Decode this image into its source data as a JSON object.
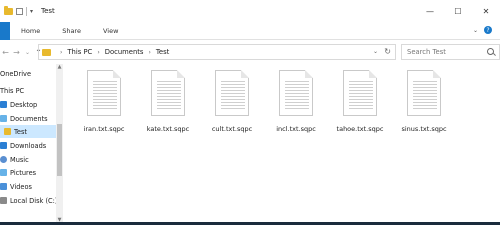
{
  "window": {
    "title": "Test",
    "controls": {
      "minimize": "—",
      "maximize": "☐",
      "close": "✕"
    }
  },
  "ribbon": {
    "tabs": [
      "Home",
      "Share",
      "View"
    ],
    "help": "?",
    "expand": "⌄"
  },
  "address": {
    "path": [
      "This PC",
      "Documents",
      "Test"
    ],
    "back": "←",
    "forward": "→",
    "dropdown": "⌄",
    "up": "↑",
    "refresh": "↻",
    "path_dropdown": "⌄"
  },
  "search": {
    "placeholder": "Search Test"
  },
  "sidebar": {
    "items": [
      {
        "label": "OneDrive",
        "icon": "cloud-icon"
      },
      {
        "label": "This PC",
        "icon": "computer-icon"
      },
      {
        "label": "Desktop",
        "icon": "desktop-icon"
      },
      {
        "label": "Documents",
        "icon": "documents-icon"
      },
      {
        "label": "Test",
        "icon": "folder-icon",
        "selected": true
      },
      {
        "label": "Downloads",
        "icon": "downloads-icon"
      },
      {
        "label": "Music",
        "icon": "music-icon"
      },
      {
        "label": "Pictures",
        "icon": "pictures-icon"
      },
      {
        "label": "Videos",
        "icon": "videos-icon"
      },
      {
        "label": "Local Disk (C:)",
        "icon": "disk-icon"
      }
    ]
  },
  "files": [
    {
      "name": "iran.txt.sqpc"
    },
    {
      "name": "kate.txt.sqpc"
    },
    {
      "name": "cult.txt.sqpc"
    },
    {
      "name": "incl.txt.sqpc"
    },
    {
      "name": "tahoe.txt.sqpc"
    },
    {
      "name": "sinus.txt.sqpc"
    }
  ],
  "colors": {
    "accent": "#1979ca",
    "folder": "#e8b92d",
    "selection": "#cce8ff"
  }
}
